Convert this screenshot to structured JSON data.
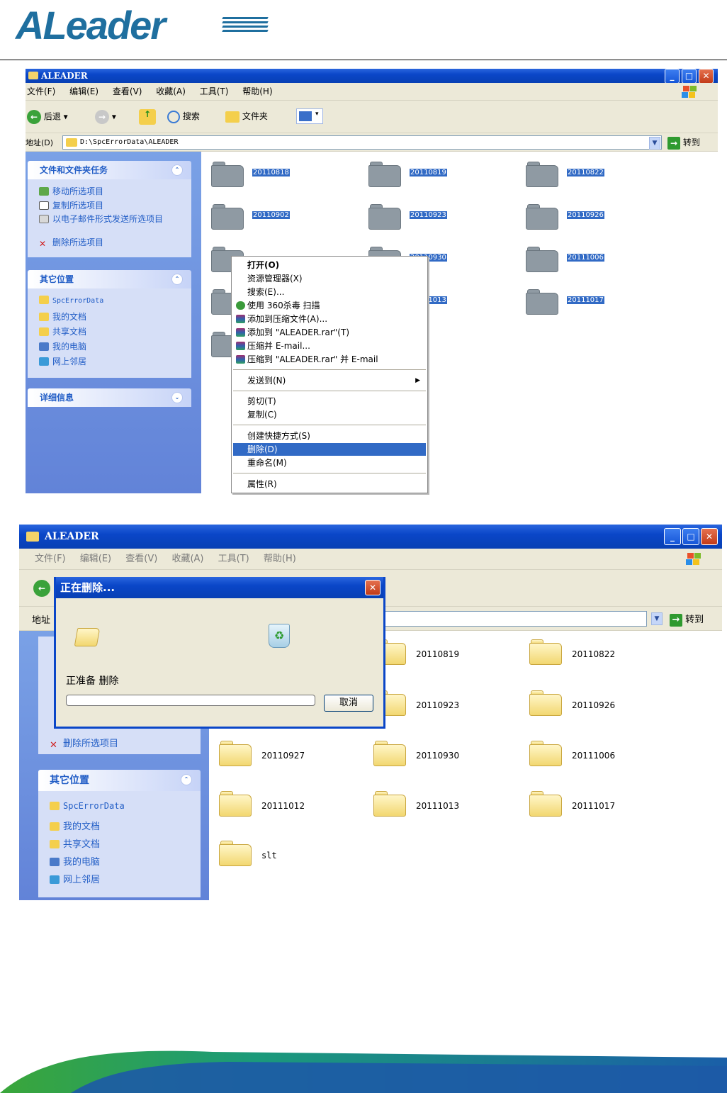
{
  "header": {
    "logo_text": "ALeader"
  },
  "window1": {
    "title": "ALEADER",
    "menu": [
      "文件(F)",
      "编辑(E)",
      "查看(V)",
      "收藏(A)",
      "工具(T)",
      "帮助(H)"
    ],
    "toolbar": {
      "back": "后退",
      "search": "搜索",
      "folders": "文件夹"
    },
    "address": {
      "label": "地址(D)",
      "path": "D:\\SpcErrorData\\ALEADER",
      "go": "转到"
    },
    "tasks": {
      "title": "文件和文件夹任务",
      "items": [
        "移动所选项目",
        "复制所选项目",
        "以电子邮件形式发送所选项目",
        "删除所选项目"
      ]
    },
    "places": {
      "title": "其它位置",
      "items": [
        "SpcErrorData",
        "我的文档",
        "共享文档",
        "我的电脑",
        "网上邻居"
      ]
    },
    "details": {
      "title": "详细信息"
    },
    "folders": [
      "20110818",
      "20110819",
      "20110822",
      "20110902",
      "20110923",
      "20110926",
      "20110930",
      "20111006",
      "20111013",
      "20111017"
    ],
    "context_menu": [
      "打开(O)",
      "资源管理器(X)",
      "搜索(E)...",
      "使用 360杀毒 扫描",
      "添加到压缩文件(A)...",
      "添加到 \"ALEADER.rar\"(T)",
      "压缩并 E-mail...",
      "压缩到 \"ALEADER.rar\" 并 E-mail",
      "发送到(N)",
      "剪切(T)",
      "复制(C)",
      "创建快捷方式(S)",
      "删除(D)",
      "重命名(M)",
      "属性(R)"
    ]
  },
  "window2": {
    "title": "ALEADER",
    "menu": [
      "文件(F)",
      "编辑(E)",
      "查看(V)",
      "收藏(A)",
      "工具(T)",
      "帮助(H)"
    ],
    "address": {
      "label": "地址",
      "go": "转到"
    },
    "tasks_visible": [
      "删除所选项目"
    ],
    "places": {
      "title": "其它位置",
      "items": [
        "SpcErrorData",
        "我的文档",
        "共享文档",
        "我的电脑",
        "网上邻居"
      ]
    },
    "folders": [
      "20110819",
      "20110822",
      "20110923",
      "20110926",
      "20110927",
      "20110930",
      "20111006",
      "20111012",
      "20111013",
      "20111017",
      "slt"
    ],
    "dialog": {
      "title": "正在删除...",
      "status": "正准备 删除",
      "progress": 0,
      "cancel": "取消"
    }
  }
}
